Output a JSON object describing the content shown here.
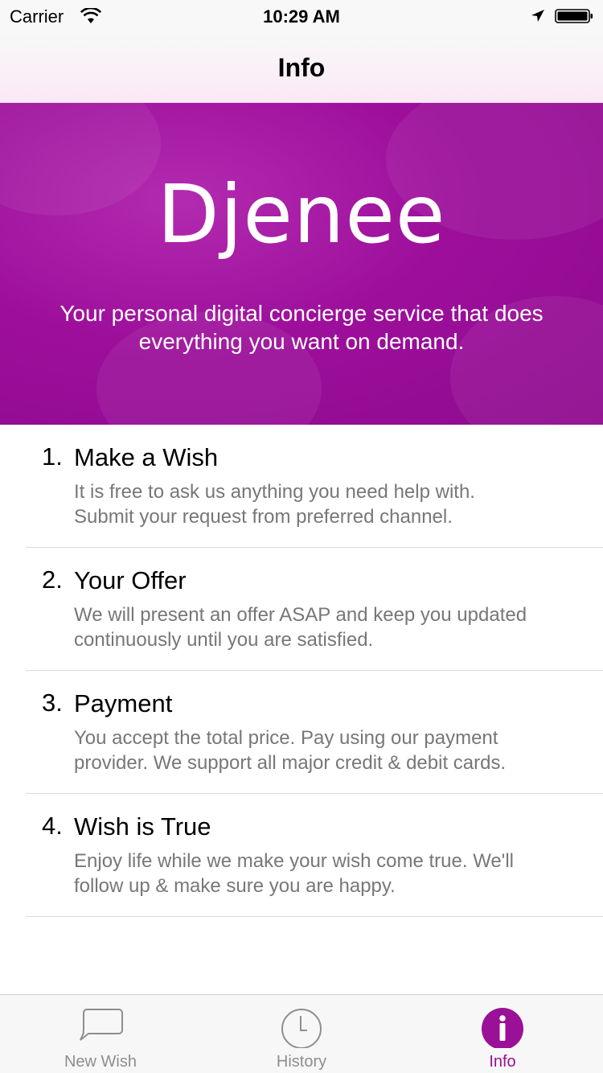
{
  "status_bar": {
    "carrier": "Carrier",
    "time": "10:29 AM",
    "icons": [
      "wifi-icon",
      "location-arrow-icon",
      "battery-icon"
    ]
  },
  "nav": {
    "title": "Info"
  },
  "hero": {
    "logo_text": "Djenee",
    "tagline": "Your personal digital concierge service that does everything you want on demand.",
    "background_color": "#9d0f9b"
  },
  "steps": [
    {
      "number": "1.",
      "title": "Make a Wish",
      "description": "It is free to ask us anything you need help with. Submit your request from preferred channel."
    },
    {
      "number": "2.",
      "title": "Your Offer",
      "description": "We will present an offer ASAP and keep you updated continuously until you are satisfied."
    },
    {
      "number": "3.",
      "title": "Payment",
      "description": "You accept the total price. Pay using our payment provider. We support all major credit & debit cards."
    },
    {
      "number": "4.",
      "title": "Wish is True",
      "description": "Enjoy life while we make your wish come true. We'll follow up & make sure you are happy."
    }
  ],
  "tabs": [
    {
      "label": "New Wish",
      "icon": "speech-bubble-icon",
      "active": false
    },
    {
      "label": "History",
      "icon": "clock-icon",
      "active": false
    },
    {
      "label": "Info",
      "icon": "info-icon",
      "active": true
    }
  ],
  "colors": {
    "accent": "#9a1096",
    "inactive_tab": "#8e8e8e",
    "secondary_text": "#777777"
  }
}
